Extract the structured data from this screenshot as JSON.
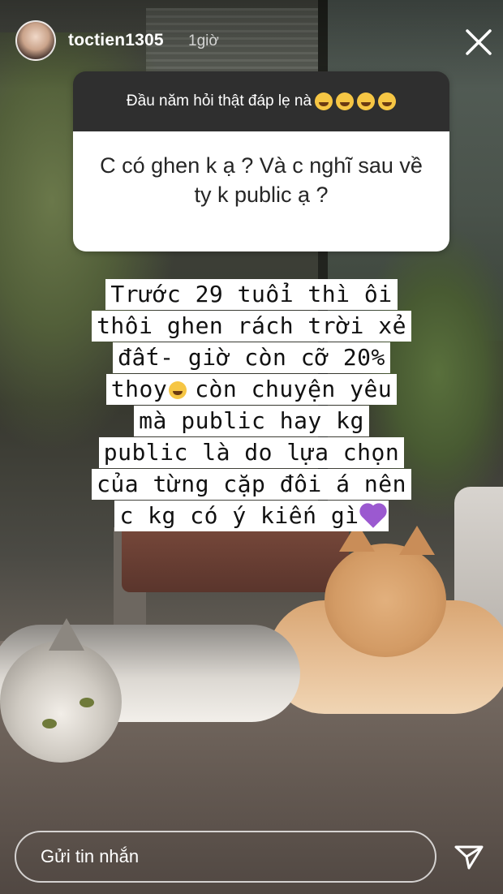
{
  "header": {
    "username": "toctien1305",
    "time": "1giờ"
  },
  "question": {
    "prompt": "Đầu năm hỏi thật đáp lẹ nà",
    "text": "C có ghen k ạ ? Và c nghĩ sau về ty k public ạ ?"
  },
  "answer": {
    "lines": [
      "Trước 29 tuổi thì ôi",
      "thôi ghen rách trời xẻ",
      "đất- giờ còn cỡ 20%",
      "thoy",
      "còn chuyện yêu",
      "mà public hay kg",
      "public là do lựa chọn",
      "của từng cặp đôi á nên",
      "c kg có ý kiến gì"
    ]
  },
  "footer": {
    "reply_placeholder": "Gửi tin nhắn"
  },
  "icons": {
    "close": "close-icon",
    "send": "send-icon",
    "emoji": "emoji-icon",
    "heart": "purple-heart-icon"
  },
  "colors": {
    "sticker_header": "#2f2f2f",
    "sticker_body": "#ffffff",
    "answer_highlight": "#ffffff",
    "heart": "#9b59d0"
  }
}
